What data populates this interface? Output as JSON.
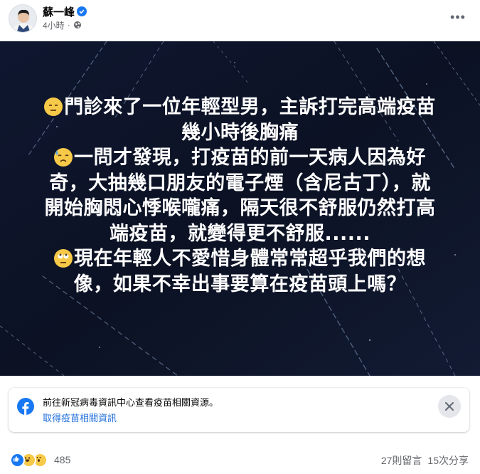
{
  "post": {
    "author": "蘇一峰",
    "timestamp": "4小時",
    "separator": "·",
    "more_label": "•••"
  },
  "image_text": {
    "line1": "門診來了一位年輕型男，主訴打完高端疫苗",
    "line2": "幾小時後胸痛",
    "line3": "一問才發現，打疫苗的前一天病人因為好",
    "line4": "奇，大抽幾口朋友的電子煙（含尼古丁），就",
    "line5": "開始胸悶心悸喉嚨痛，隔天很不舒服仍然打高",
    "line6": "端疫苗，就變得更不舒服......",
    "line7": "現在年輕人不愛惜身體常常超乎我們的想",
    "line8": "像，如果不幸出事要算在疫苗頭上嗎？"
  },
  "info_card": {
    "text": "前往新冠病毒資訊中心查看疫苗相關資源。",
    "link": "取得疫苗相關資訊"
  },
  "footer": {
    "reaction_count": "485",
    "comments": "27則留言",
    "shares": "15次分享"
  },
  "colors": {
    "accent": "#1877f2",
    "image_bg": "#0e1426",
    "link": "#216fdb"
  }
}
